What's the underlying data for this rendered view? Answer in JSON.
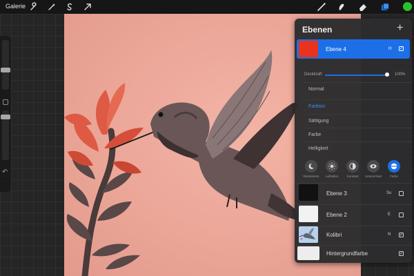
{
  "topbar": {
    "gallery_label": "Galerie",
    "tools_left": [
      "wrench-icon",
      "magic-wand-icon",
      "selection-icon",
      "transform-arrow-icon"
    ],
    "tools_right": [
      "brush-icon",
      "smudge-icon",
      "eraser-icon",
      "layers-icon"
    ],
    "active_color": "#2bc12b"
  },
  "layers_panel": {
    "title": "Ebenen",
    "add_label": "+",
    "active_layer": {
      "name": "Ebene 4",
      "blend_code": "H",
      "visible": true,
      "thumb_color": "#e8331f"
    },
    "opacity_label": "Deckkraft",
    "opacity_value": "100%",
    "opacity_fraction": 1.0,
    "blend_modes": [
      "Normal",
      "Farbton",
      "Sättigung",
      "Farbe",
      "Helligkeit"
    ],
    "selected_blend_mode": "Farbton",
    "mode_buttons": [
      {
        "label": "Reduzieren",
        "icon": "moon-icon"
      },
      {
        "label": "Aufhellen",
        "icon": "sun-icon"
      },
      {
        "label": "Kontrast",
        "icon": "contrast-icon"
      },
      {
        "label": "Unterschied",
        "icon": "difference-icon"
      },
      {
        "label": "Farbe",
        "icon": "hue-icon",
        "active": true
      }
    ],
    "layers": [
      {
        "name": "Ebene 3",
        "blend_code": "Su",
        "visible": false,
        "thumb_color": "#111111"
      },
      {
        "name": "Ebene 2",
        "blend_code": "E",
        "visible": false,
        "thumb_color": "#f2f2f2"
      },
      {
        "name": "Kolibri",
        "blend_code": "N",
        "visible": true,
        "thumb_color": "#a9c6e8"
      },
      {
        "name": "Hintergrundfarbe",
        "blend_code": "",
        "visible": true,
        "thumb_color": "#ededed"
      }
    ]
  },
  "colors": {
    "accent": "#1d6fe8",
    "canvas_background": "#eba698",
    "flower": "#e0553f"
  }
}
